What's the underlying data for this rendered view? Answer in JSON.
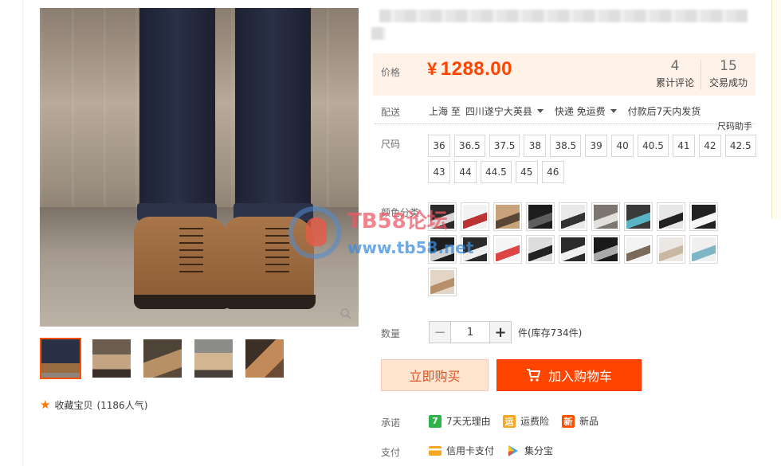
{
  "title_text": "",
  "price": {
    "label": "价格",
    "currency": "¥",
    "value": "1288.00"
  },
  "stats": {
    "reviews": {
      "count": "4",
      "label": "累计评论"
    },
    "sales": {
      "count": "15",
      "label": "交易成功"
    }
  },
  "delivery": {
    "label": "配送",
    "from": "上海 至",
    "to": "四川遂宁大英县",
    "method": "快递 免运费",
    "ship_time": "付款后7天内发货"
  },
  "size": {
    "label": "尺码",
    "helper": "尺码助手",
    "options": [
      "36",
      "36.5",
      "37.5",
      "38",
      "38.5",
      "39",
      "40",
      "40.5",
      "41",
      "42",
      "42.5",
      "43",
      "44",
      "44.5",
      "45",
      "46"
    ]
  },
  "color": {
    "label": "颜色分类",
    "swatches": [
      {
        "c1": "#2b2b2b",
        "c2": "#d8d8d8"
      },
      {
        "c1": "#f2f2f2",
        "c2": "#b33"
      },
      {
        "c1": "#c8a27a",
        "c2": "#5a4636"
      },
      {
        "c1": "#1d1d1d",
        "c2": "#5e5e5e"
      },
      {
        "c1": "#e9e9e9",
        "c2": "#333"
      },
      {
        "c1": "#7c7670",
        "c2": "#e2e0dc"
      },
      {
        "c1": "#3a3a3a",
        "c2": "#5ab3c2"
      },
      {
        "c1": "#e6e6e6",
        "c2": "#222"
      },
      {
        "c1": "#222",
        "c2": "#f5f5f5"
      },
      {
        "c1": "#1e1e1e",
        "c2": "#d0d0d0"
      },
      {
        "c1": "#2a2a2a",
        "c2": "#eee"
      },
      {
        "c1": "#f5f5f5",
        "c2": "#d44"
      },
      {
        "c1": "#ddd",
        "c2": "#222"
      },
      {
        "c1": "#2b2b2b",
        "c2": "#f0f0f0"
      },
      {
        "c1": "#1a1a1a",
        "c2": "#aaa"
      },
      {
        "c1": "#f3f3f3",
        "c2": "#7b6a59"
      },
      {
        "c1": "#ebe8e3",
        "c2": "#c9b8a2"
      },
      {
        "c1": "#f0f0f0",
        "c2": "#7fb6c6"
      },
      {
        "c1": "#e3d5c6",
        "c2": "#b88f6b"
      }
    ]
  },
  "watermark": {
    "title": "TB58论坛",
    "url": "www.tb58.net"
  },
  "quantity": {
    "label": "数量",
    "value": "1",
    "minus": "−",
    "plus": "+",
    "stock": "件(库存734件)"
  },
  "buttons": {
    "buy_now": "立即购买",
    "add_cart": "加入购物车"
  },
  "promise": {
    "label": "承诺",
    "items": [
      {
        "badge": "7",
        "text": "7天无理由",
        "color": "#2db34a"
      },
      {
        "badge": "运",
        "text": "运费险",
        "color": "#f5a623"
      },
      {
        "badge": "新",
        "text": "新品",
        "color": "#ff5000"
      }
    ]
  },
  "payment": {
    "label": "支付",
    "items": [
      {
        "text": "信用卡支付",
        "color": "#f5a623"
      },
      {
        "text": "集分宝",
        "color": "#3aa6e8"
      }
    ]
  },
  "favorite": {
    "text": "收藏宝贝",
    "count": "(1186人气)"
  }
}
